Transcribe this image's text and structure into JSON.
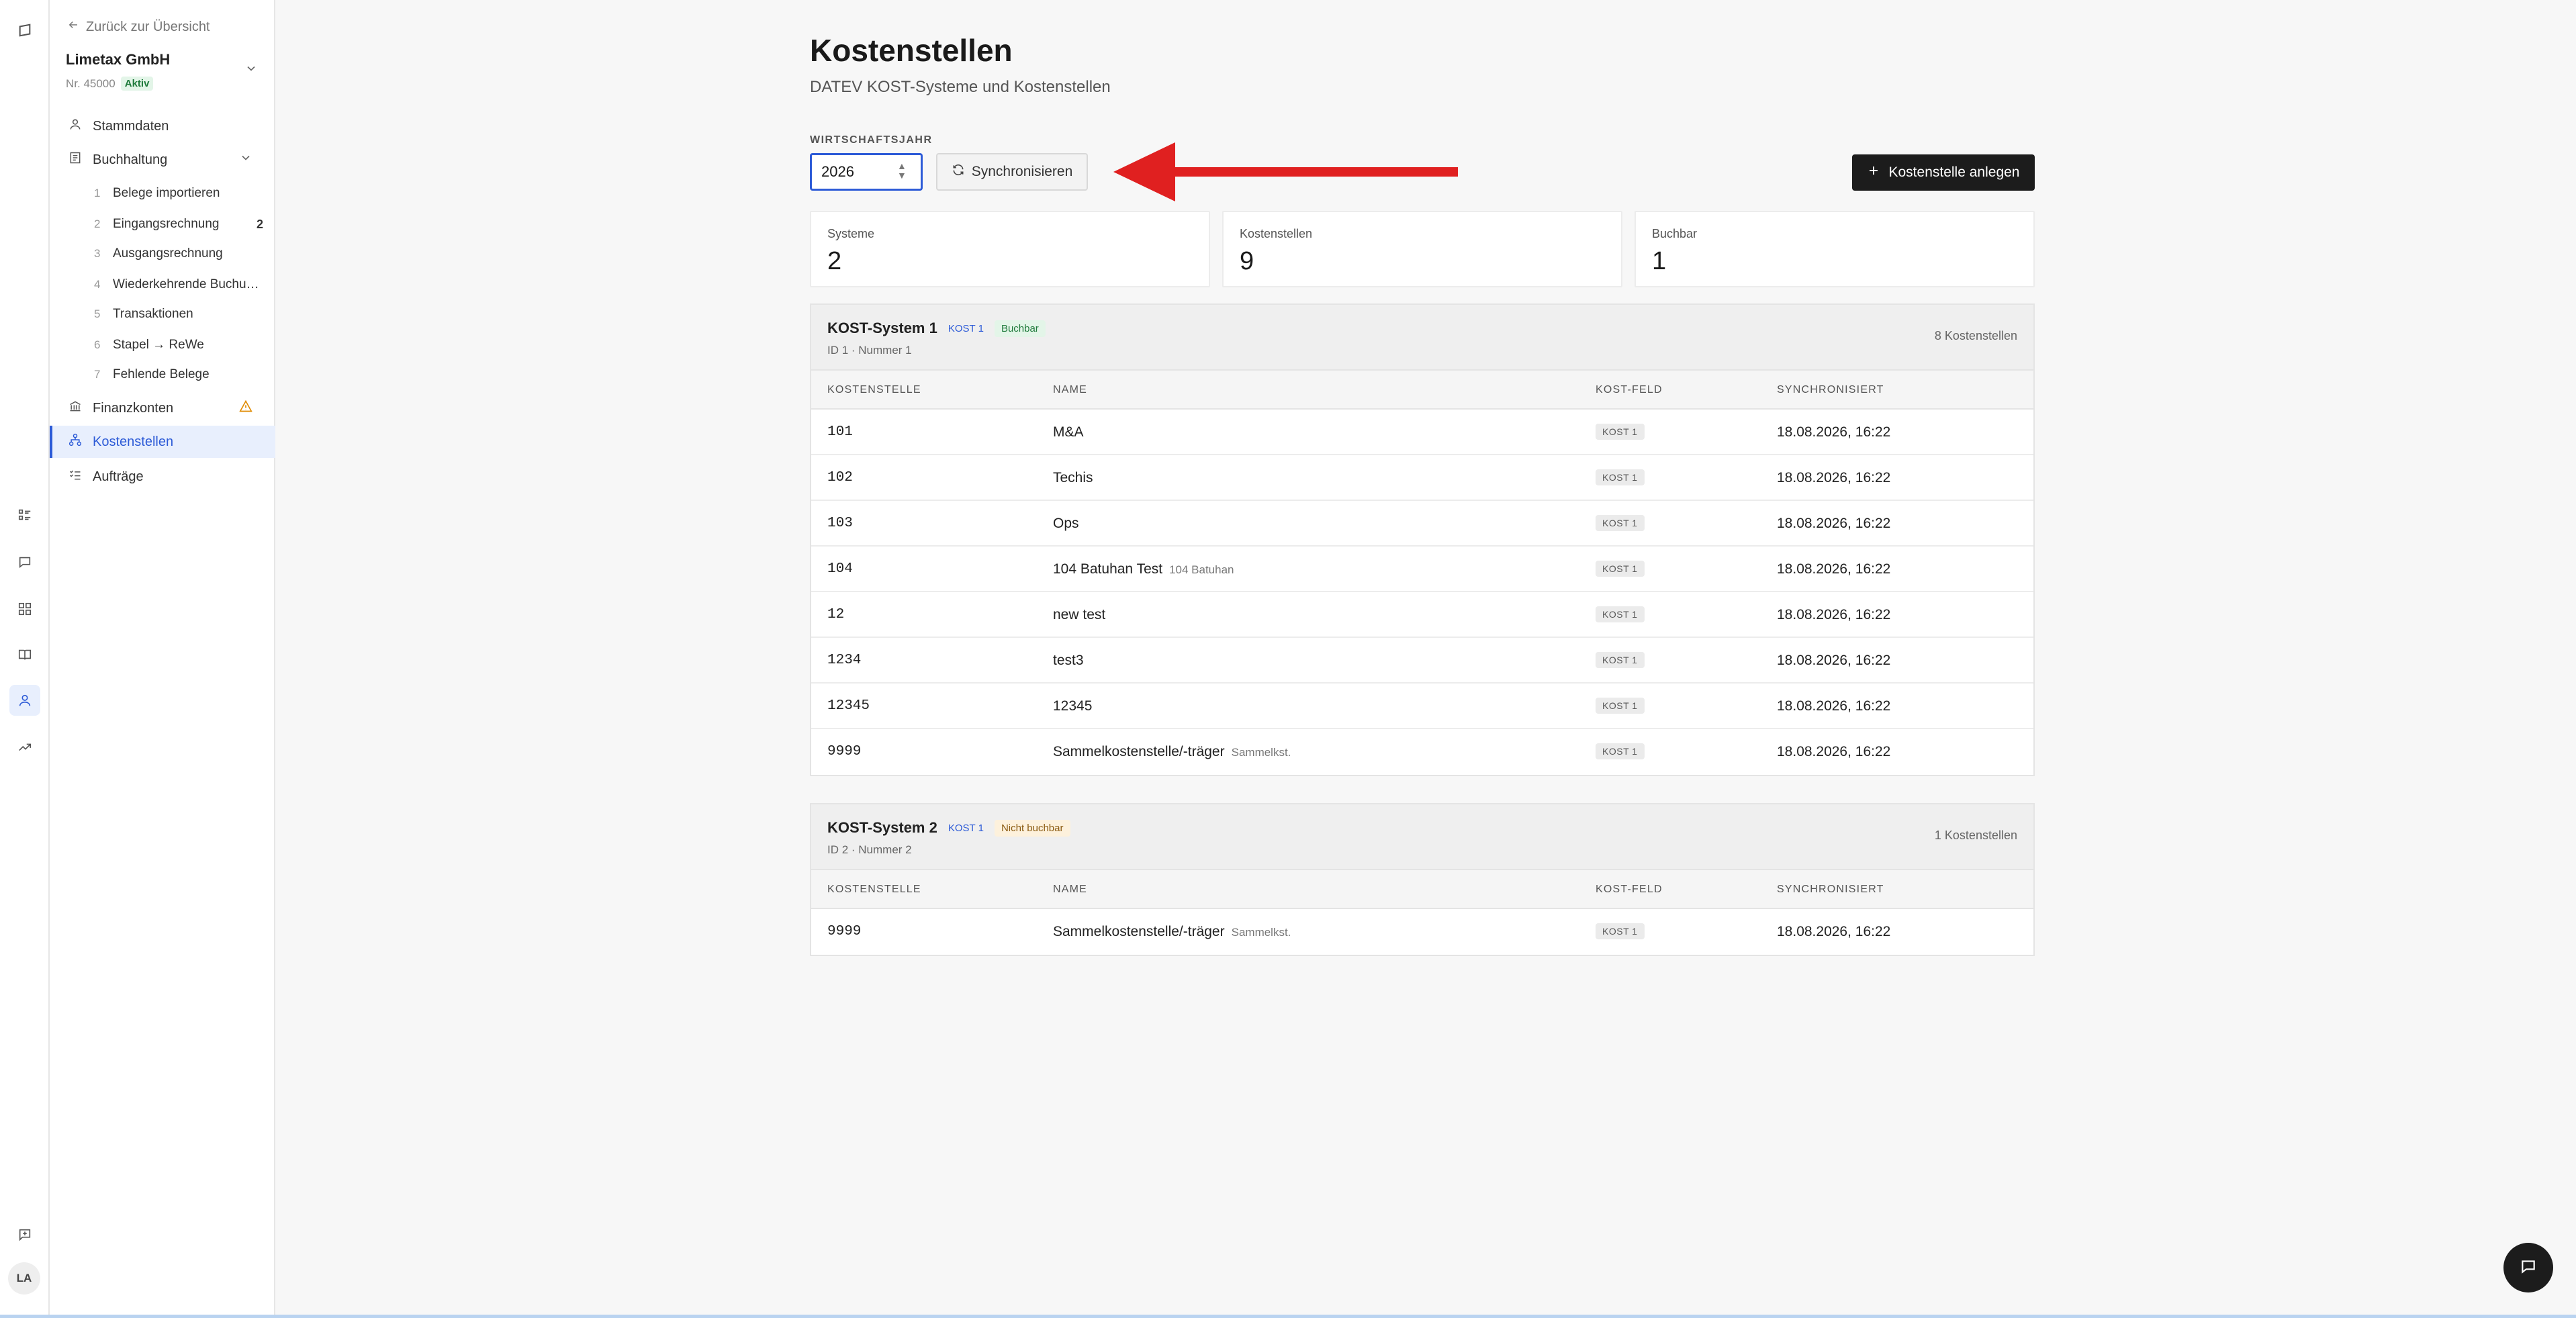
{
  "rail": {
    "icons": [
      "grid-list-icon",
      "chat-icon",
      "apps-icon",
      "book-icon",
      "user-icon",
      "trending-icon",
      "feedback-icon"
    ],
    "avatar_initials": "LA"
  },
  "sidebar": {
    "back_label": "Zurück zur Übersicht",
    "company_name": "Limetax GmbH",
    "company_number": "Nr. 45000",
    "company_status": "Aktiv",
    "items": [
      {
        "label": "Stammdaten",
        "icon": "user-icon"
      },
      {
        "label": "Buchhaltung",
        "icon": "ledger-icon"
      },
      {
        "label": "Finanzkonten",
        "icon": "bank-icon"
      },
      {
        "label": "Kostenstellen",
        "icon": "hierarchy-icon"
      },
      {
        "label": "Aufträge",
        "icon": "checklist-icon"
      }
    ],
    "sub_items": [
      {
        "num": "1",
        "label": "Belege importieren",
        "count": ""
      },
      {
        "num": "2",
        "label": "Eingangsrechnung",
        "count": "2"
      },
      {
        "num": "3",
        "label": "Ausgangsrechnung",
        "count": ""
      },
      {
        "num": "4",
        "label": "Wiederkehrende Buchungen",
        "count": ""
      },
      {
        "num": "5",
        "label": "Transaktionen",
        "count": ""
      },
      {
        "num": "6",
        "label": "Stapel → ReWe",
        "count": ""
      },
      {
        "num": "7",
        "label": "Fehlende Belege",
        "count": ""
      }
    ]
  },
  "main": {
    "title": "Kostenstellen",
    "subtitle": "DATEV KOST-Systeme und Kostenstellen",
    "year_label": "WIRTSCHAFTSJAHR",
    "year_value": "2026",
    "sync_label": "Synchronisieren",
    "add_label": "Kostenstelle anlegen",
    "stats": [
      {
        "label": "Systeme",
        "value": "2"
      },
      {
        "label": "Kostenstellen",
        "value": "9"
      },
      {
        "label": "Buchbar",
        "value": "1"
      }
    ],
    "columns": [
      "KOSTENSTELLE",
      "NAME",
      "KOST-FELD",
      "SYNCHRONISIERT"
    ],
    "systems": [
      {
        "title": "KOST-System 1",
        "kost_tag": "KOST 1",
        "status": "Buchbar",
        "meta": "ID 1 · Nummer 1",
        "count": "8 Kostenstellen",
        "rows": [
          {
            "code": "101",
            "name": "M&A",
            "note": "",
            "feld": "KOST 1",
            "sync": "18.08.2026, 16:22"
          },
          {
            "code": "102",
            "name": "Techis",
            "note": "",
            "feld": "KOST 1",
            "sync": "18.08.2026, 16:22"
          },
          {
            "code": "103",
            "name": "Ops",
            "note": "",
            "feld": "KOST 1",
            "sync": "18.08.2026, 16:22"
          },
          {
            "code": "104",
            "name": "104 Batuhan Test",
            "note": "104 Batuhan",
            "feld": "KOST 1",
            "sync": "18.08.2026, 16:22"
          },
          {
            "code": "12",
            "name": "new test",
            "note": "",
            "feld": "KOST 1",
            "sync": "18.08.2026, 16:22"
          },
          {
            "code": "1234",
            "name": "test3",
            "note": "",
            "feld": "KOST 1",
            "sync": "18.08.2026, 16:22"
          },
          {
            "code": "12345",
            "name": "12345",
            "note": "",
            "feld": "KOST 1",
            "sync": "18.08.2026, 16:22"
          },
          {
            "code": "9999",
            "name": "Sammelkostenstelle/-träger",
            "note": "Sammelkst.",
            "feld": "KOST 1",
            "sync": "18.08.2026, 16:22"
          }
        ]
      },
      {
        "title": "KOST-System 2",
        "kost_tag": "KOST 1",
        "status": "Nicht buchbar",
        "meta": "ID 2 · Nummer 2",
        "count": "1 Kostenstellen",
        "rows": [
          {
            "code": "9999",
            "name": "Sammelkostenstelle/-träger",
            "note": "Sammelkst.",
            "feld": "KOST 1",
            "sync": "18.08.2026, 16:22"
          }
        ]
      }
    ]
  },
  "colors": {
    "accent": "#2d5bd7",
    "arrow": "#e02020",
    "primary_button": "#1c1c1c",
    "buchbar_bg": "#e3f5e8",
    "nicht_buchbar_bg": "#fdf1dc"
  }
}
